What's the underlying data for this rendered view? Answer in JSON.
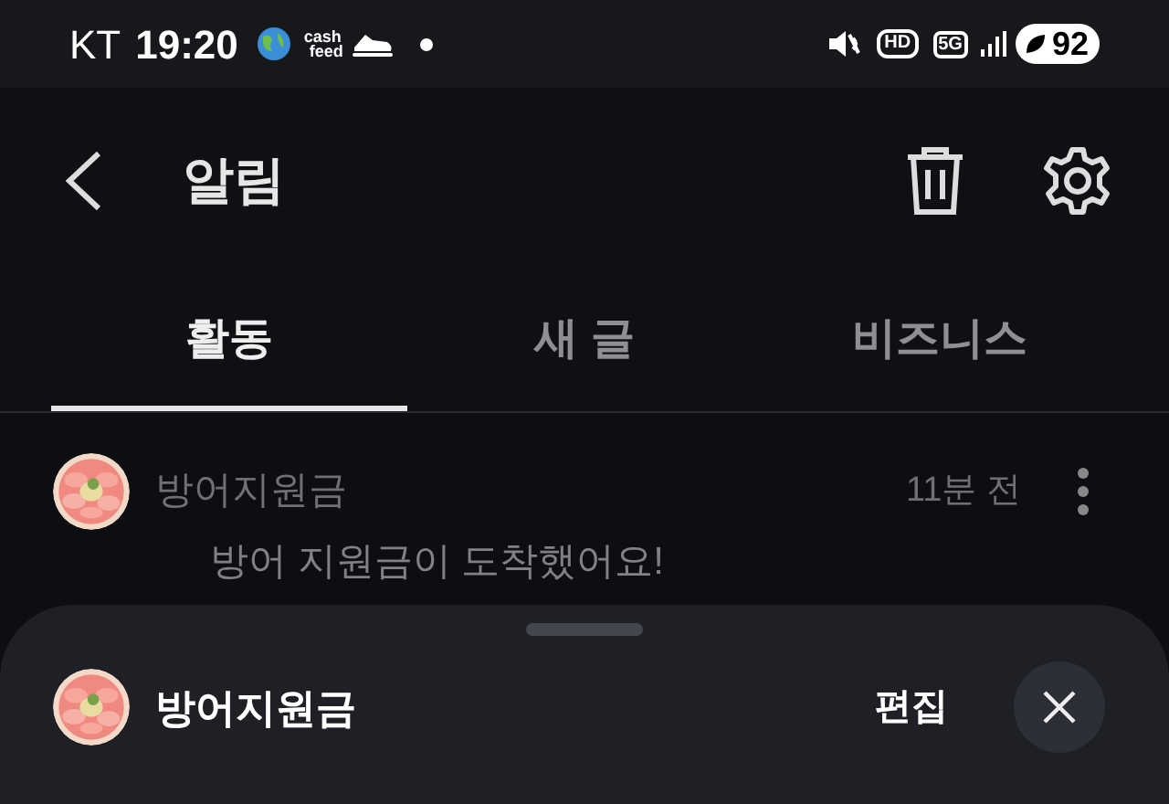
{
  "status_bar": {
    "carrier": "KT",
    "time": "19:20",
    "app_badge": [
      "cash",
      "feed"
    ],
    "network": "5G",
    "hd": "HD",
    "battery": "92"
  },
  "header": {
    "title": "알림"
  },
  "tabs": [
    {
      "label": "활동",
      "selected": true
    },
    {
      "label": "새 글",
      "selected": false
    },
    {
      "label": "비즈니스",
      "selected": false
    }
  ],
  "notifications": [
    {
      "sender": "방어지원금",
      "time": "11분 전",
      "message": "방어 지원금이 도착했어요!"
    }
  ],
  "bottom_sheet": {
    "name": "방어지원금",
    "edit_button": "편집"
  }
}
